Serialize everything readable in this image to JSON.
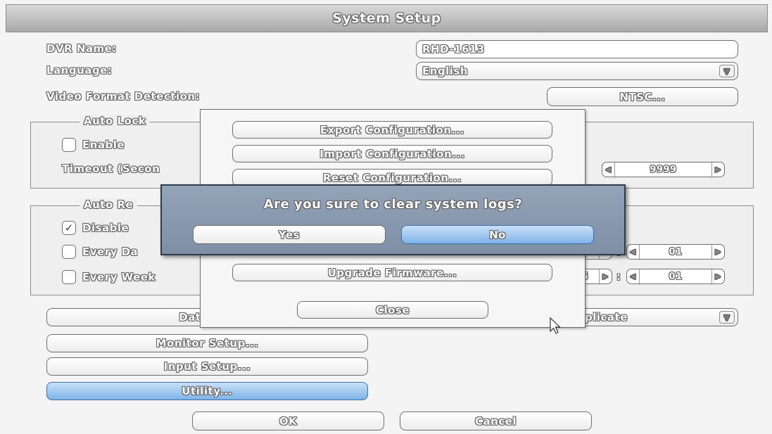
{
  "title": "System Setup",
  "dvr_name": {
    "label": "DVR Name:",
    "value": "RHD-1613"
  },
  "language": {
    "label": "Language:",
    "value": "English"
  },
  "video_format": {
    "label": "Video Format Detection:",
    "value": "NTSC..."
  },
  "auto_lock": {
    "legend": "Auto Lock",
    "enable_label": "Enable",
    "enable_checked": false,
    "timeout_label": "Timeout (Secon",
    "timeout_value": "9999"
  },
  "auto_reboot": {
    "legend": "Auto Re",
    "disable_label": "Disable",
    "disable_checked": true,
    "every_day_label": "Every Da",
    "every_week_label": "Every Week",
    "day_hour_fragment": "",
    "day_minute": "01",
    "week_hour_fragment": "5",
    "week_minute": "01",
    "separator": ":"
  },
  "left_menu": {
    "datetime_label": "Date/Tim",
    "monitor_label": "Monitor Setup...",
    "input_label": "Input Setup...",
    "utility_label": "Utility..."
  },
  "duplicate_dropdown": {
    "value": "plicate"
  },
  "footer": {
    "ok_label": "OK",
    "cancel_label": "Cancel"
  },
  "utility_panel": {
    "export_label": "Export Configuration...",
    "import_label": "Import Configuration...",
    "reset_label": "Reset Configuration...",
    "upgrade_label": "Upgrade Firmware...",
    "close_label": "Close"
  },
  "confirm_dialog": {
    "message": "Are you sure to clear system logs?",
    "yes_label": "Yes",
    "no_label": "No"
  },
  "icons": {
    "dropdown": "chevron-down-icon",
    "spin_left": "triangle-left-icon",
    "spin_right": "triangle-right-icon",
    "check": "check-icon",
    "cursor": "mouse-pointer-icon"
  },
  "colors": {
    "selected_button": "#7fb3e8",
    "dialog_background": "#8797ad",
    "title_gradient": "#a9a9a9"
  }
}
